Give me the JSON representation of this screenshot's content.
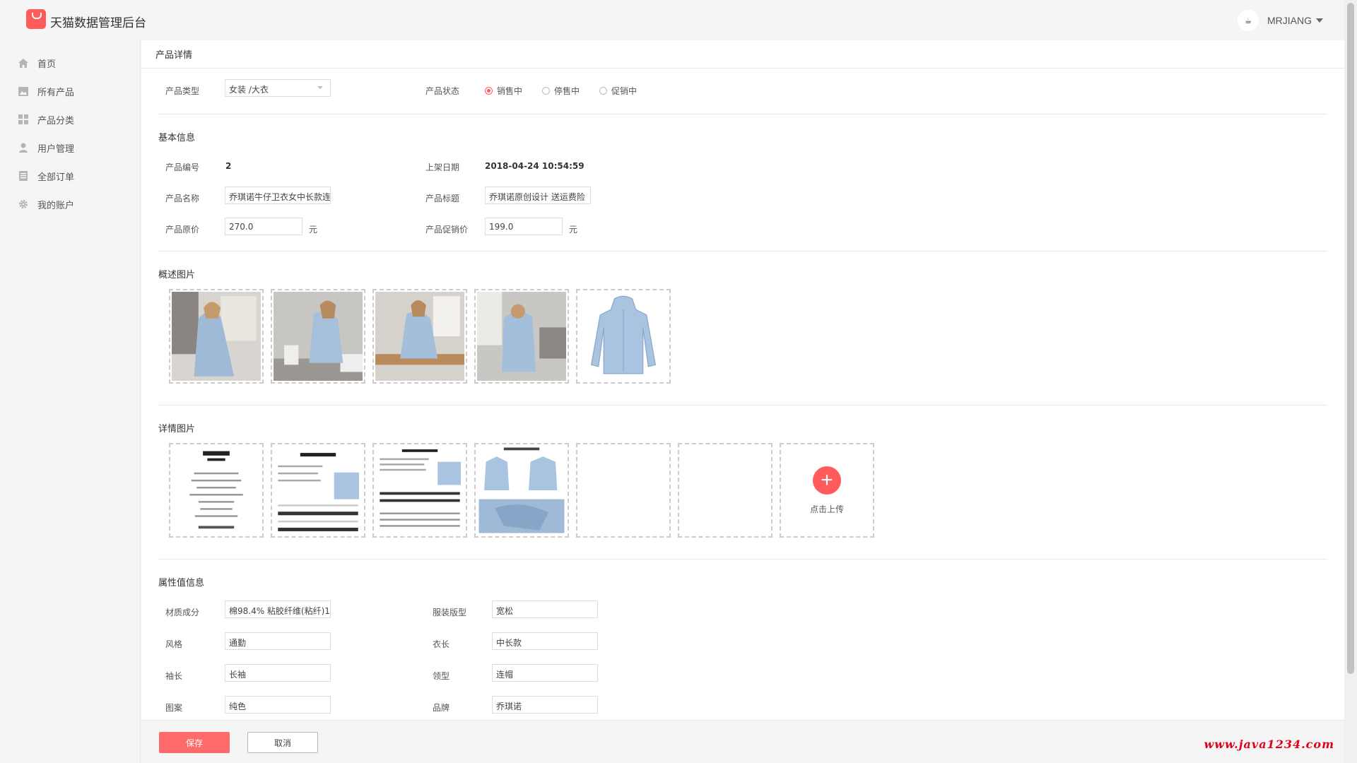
{
  "header": {
    "app_title": "天猫数据管理后台",
    "user_name": "MRJIANG",
    "avatar_glyph": "☕"
  },
  "sidebar": {
    "items": [
      {
        "label": "首页",
        "icon": "home-icon"
      },
      {
        "label": "所有产品",
        "icon": "image-icon"
      },
      {
        "label": "产品分类",
        "icon": "grid-icon"
      },
      {
        "label": "用户管理",
        "icon": "user-icon"
      },
      {
        "label": "全部订单",
        "icon": "document-icon"
      },
      {
        "label": "我的账户",
        "icon": "gear-icon"
      }
    ]
  },
  "page": {
    "title": "产品详情",
    "type_label": "产品类型",
    "type_value": "女装 /大衣",
    "status_label": "产品状态",
    "status_options": [
      {
        "label": "销售中",
        "selected": true
      },
      {
        "label": "停售中",
        "selected": false
      },
      {
        "label": "促销中",
        "selected": false
      }
    ]
  },
  "basic": {
    "section_title": "基本信息",
    "id_label": "产品编号",
    "id_value": "2",
    "date_label": "上架日期",
    "date_value": "2018-04-24 10:54:59",
    "name_label": "产品名称",
    "name_value": "乔琪诺牛仔卫衣女中长款连",
    "title_label": "产品标题",
    "title_value": "乔琪诺原创设计 送运费险",
    "price_label": "产品原价",
    "price_value": "270.0",
    "price_unit": "元",
    "promo_label": "产品促销价",
    "promo_value": "199.0",
    "promo_unit": "元"
  },
  "overview": {
    "section_title": "概述图片",
    "image_count": 5
  },
  "detail": {
    "section_title": "详情图片",
    "image_count": 4,
    "empty_slots": 2,
    "upload_label": "点击上传"
  },
  "attributes": {
    "section_title": "属性值信息",
    "items": [
      {
        "label": "材质成分",
        "value": "棉98.4% 粘胶纤维(粘纤)1."
      },
      {
        "label": "服装版型",
        "value": "宽松"
      },
      {
        "label": "风格",
        "value": "通勤"
      },
      {
        "label": "衣长",
        "value": "中长款"
      },
      {
        "label": "袖长",
        "value": "长袖"
      },
      {
        "label": "领型",
        "value": "连帽"
      },
      {
        "label": "图案",
        "value": "纯色"
      },
      {
        "label": "品牌",
        "value": "乔琪诺"
      }
    ]
  },
  "footer": {
    "save_label": "保存",
    "cancel_label": "取消",
    "watermark": "www.java1234.com"
  },
  "colors": {
    "accent": "#ff5b5b",
    "denim": "#a9c4e0"
  }
}
